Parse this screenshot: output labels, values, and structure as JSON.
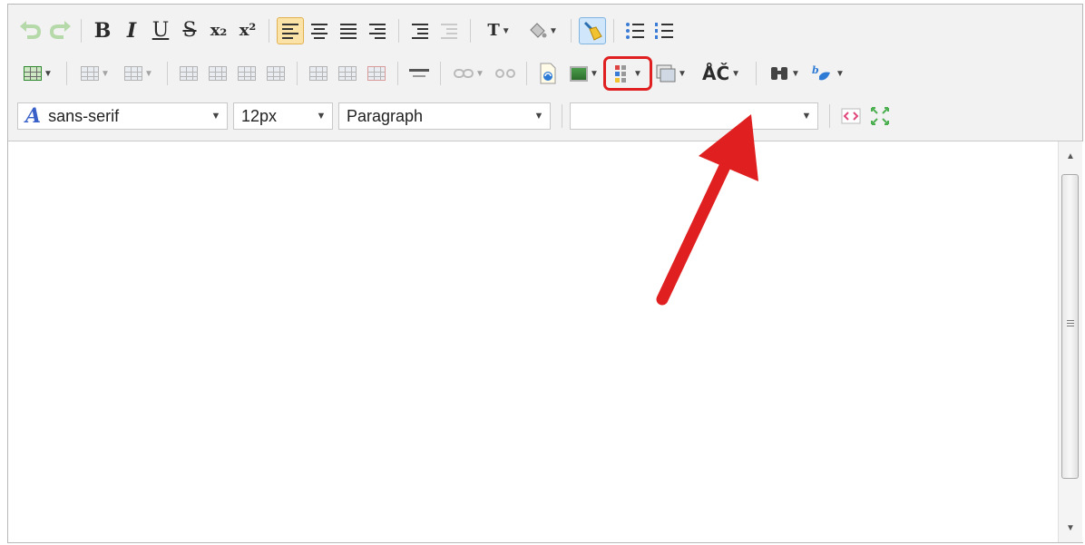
{
  "toolbar": {
    "row1": {
      "bold": "B",
      "italic": "I",
      "underline": "U",
      "strike": "S",
      "subscript": "x₂",
      "superscript": "x²",
      "text_color": "T"
    },
    "row2": {
      "special_chars": "ÅČ"
    },
    "row3": {
      "font_family": "sans-serif",
      "font_size": "12px",
      "format": "Paragraph",
      "style": ""
    }
  },
  "colors": {
    "annotation_red": "#e02020",
    "active_bg": "#fbe3a8"
  }
}
